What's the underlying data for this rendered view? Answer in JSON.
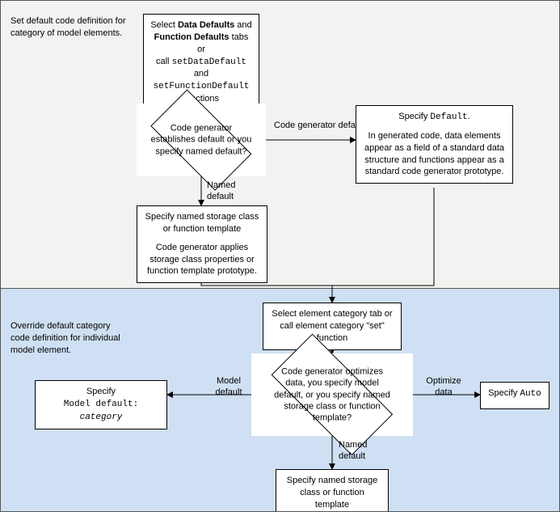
{
  "captions": {
    "top": "Set default code definition for category of model elements.",
    "bottom": "Override default category code definition for individual model element."
  },
  "top": {
    "startBox": {
      "l1_pre": "Select ",
      "l1_b1": "Data Defaults",
      "l1_mid": " and ",
      "l2_b2": "Function Defaults",
      "l2_post": " tabs",
      "l3": "or",
      "l4_pre": "call ",
      "l4_m1": "setDataDefault",
      "l4_post": " and ",
      "l5_m2": "setFunctionDefault",
      "l5_post": " functions"
    },
    "decision": "Code generator establishes default or you specify named default?",
    "rightBox": {
      "l1_pre": "Specify ",
      "l1_mono": "Default",
      "l1_post": ".",
      "l2": "In generated code, data elements appear as a field of a standard data structure and functions appear as a standard code generator prototype."
    },
    "leftBox": {
      "l1": "Specify named storage class or function template",
      "l2": "Code generator applies storage class properties or function template prototype."
    },
    "edgeRight": "Code generator default",
    "edgeDown": "Named default"
  },
  "bottom": {
    "entryBox": "Select element category tab or call element category \"set\" function",
    "decision": "Code generator optimizes data, you  specify model default, or you specify named storage class or function template?",
    "leftBox": {
      "l1": "Specify",
      "l2_m1": "Model default:",
      "l2_i2": "category"
    },
    "rightBox": {
      "l1_pre": "Specify ",
      "l1_mono": "Auto"
    },
    "downBox": "Specify named storage class or function template",
    "edgeLeft": "Model default",
    "edgeRight": "Optimize data",
    "edgeDown": "Named default"
  }
}
